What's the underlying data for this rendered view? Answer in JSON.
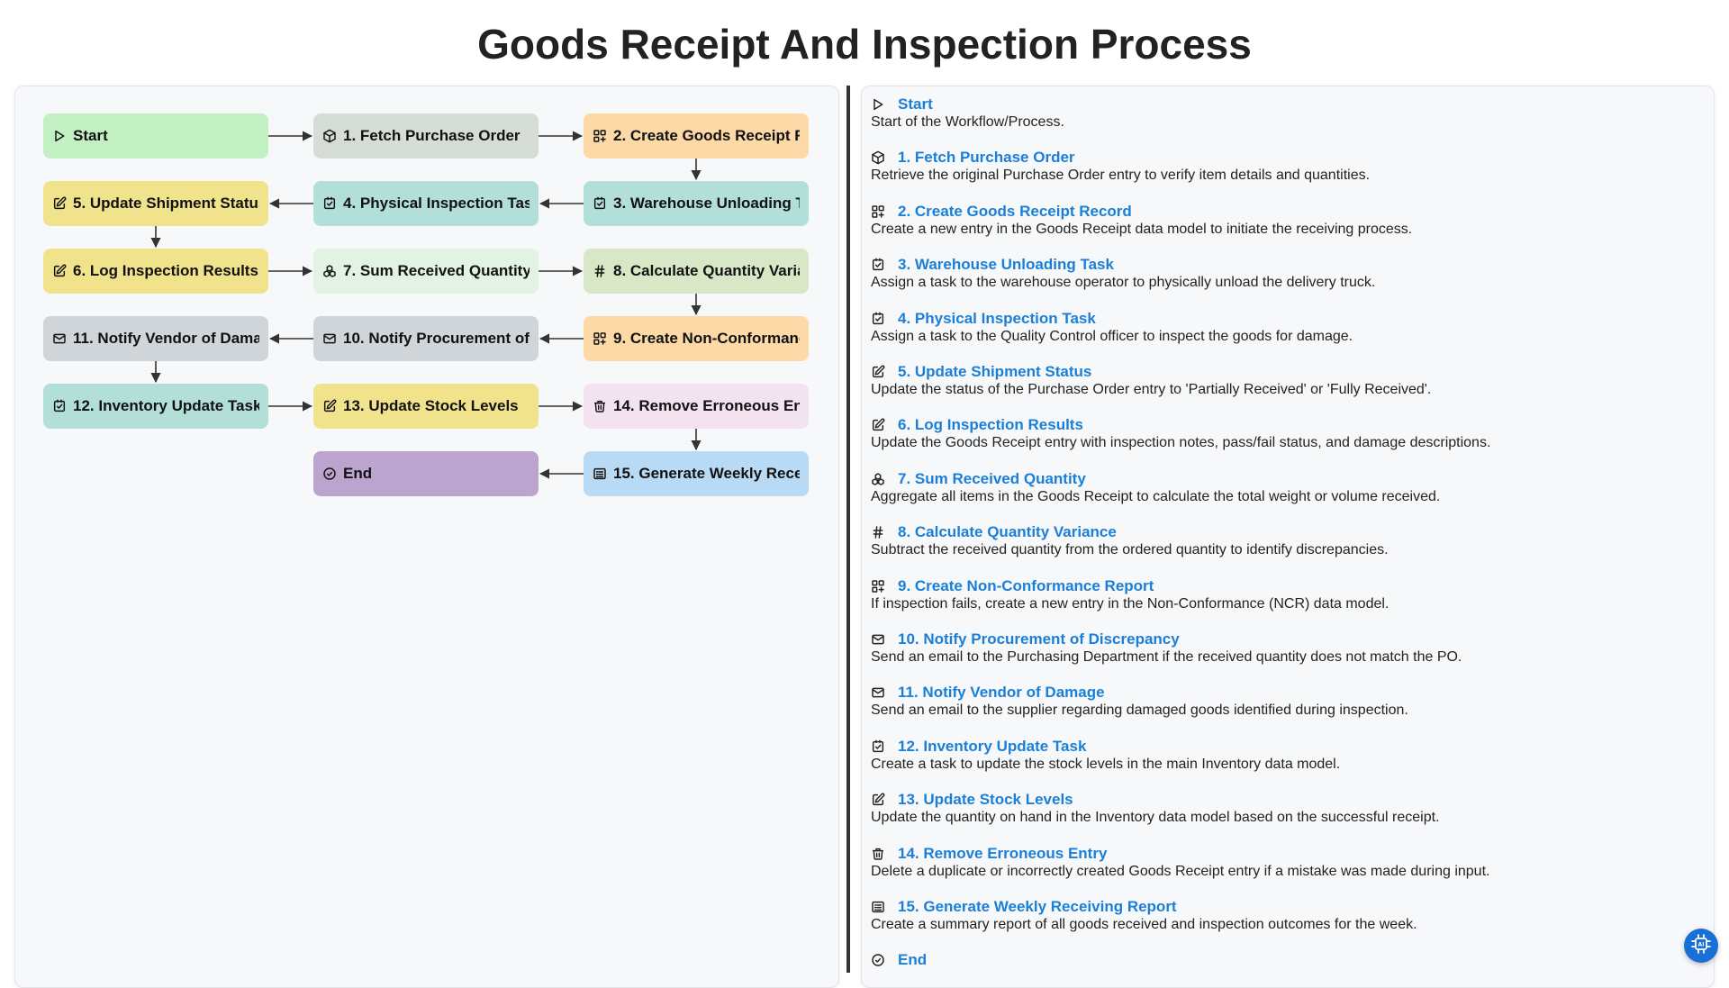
{
  "title": "Goods Receipt And Inspection Process",
  "colors": {
    "green": "#c2f0c2",
    "sage": "#d6ddd6",
    "orange": "#fdd9a8",
    "teal": "#b3dfd9",
    "yellow": "#f0e38c",
    "mint": "#e3f3e3",
    "lime": "#d8e8c6",
    "gray": "#d0d5d9",
    "pink": "#f3e3f1",
    "blue": "#b9daf5",
    "purple": "#bba5cf",
    "link": "#1a7fd8"
  },
  "nodes": [
    {
      "id": "start",
      "label": "Start",
      "icon": "play-icon",
      "color": "green"
    },
    {
      "id": "s1",
      "label": "1. Fetch Purchase Order",
      "icon": "cube-icon",
      "color": "sage"
    },
    {
      "id": "s2",
      "label": "2. Create Goods Receipt Record",
      "icon": "grid-plus-icon",
      "color": "orange"
    },
    {
      "id": "s3",
      "label": "3. Warehouse Unloading Task",
      "icon": "checkbox-icon",
      "color": "teal"
    },
    {
      "id": "s4",
      "label": "4. Physical Inspection Task",
      "icon": "checkbox-icon",
      "color": "teal"
    },
    {
      "id": "s5",
      "label": "5. Update Shipment Status",
      "icon": "edit-icon",
      "color": "yellow"
    },
    {
      "id": "s6",
      "label": "6. Log Inspection Results",
      "icon": "edit-icon",
      "color": "yellow"
    },
    {
      "id": "s7",
      "label": "7. Sum Received Quantity",
      "icon": "boxes-icon",
      "color": "mint"
    },
    {
      "id": "s8",
      "label": "8. Calculate Quantity Variance",
      "icon": "hash-icon",
      "color": "lime"
    },
    {
      "id": "s9",
      "label": "9. Create Non-Conformance Report",
      "icon": "grid-plus-icon",
      "color": "orange"
    },
    {
      "id": "s10",
      "label": "10. Notify Procurement of Discrepancy",
      "icon": "mail-icon",
      "color": "gray"
    },
    {
      "id": "s11",
      "label": "11. Notify Vendor of Damage",
      "icon": "mail-icon",
      "color": "gray"
    },
    {
      "id": "s12",
      "label": "12. Inventory Update Task",
      "icon": "checkbox-icon",
      "color": "teal"
    },
    {
      "id": "s13",
      "label": "13. Update Stock Levels",
      "icon": "edit-icon",
      "color": "yellow"
    },
    {
      "id": "s14",
      "label": "14. Remove Erroneous Entry",
      "icon": "trash-icon",
      "color": "pink"
    },
    {
      "id": "s15",
      "label": "15. Generate Weekly Receiving Report",
      "icon": "report-icon",
      "color": "blue"
    },
    {
      "id": "end",
      "label": "End",
      "icon": "check-circle-icon",
      "color": "purple"
    }
  ],
  "steps": [
    {
      "title": "Start",
      "icon": "play-icon",
      "desc": "Start of the Workflow/Process."
    },
    {
      "title": "1. Fetch Purchase Order",
      "icon": "cube-icon",
      "desc": "Retrieve the original Purchase Order entry to verify item details and quantities."
    },
    {
      "title": "2. Create Goods Receipt Record",
      "icon": "grid-plus-icon",
      "desc": "Create a new entry in the Goods Receipt data model to initiate the receiving process."
    },
    {
      "title": "3. Warehouse Unloading Task",
      "icon": "checkbox-icon",
      "desc": "Assign a task to the warehouse operator to physically unload the delivery truck."
    },
    {
      "title": "4. Physical Inspection Task",
      "icon": "checkbox-icon",
      "desc": "Assign a task to the Quality Control officer to inspect the goods for damage."
    },
    {
      "title": "5. Update Shipment Status",
      "icon": "edit-icon",
      "desc": "Update the status of the Purchase Order entry to 'Partially Received' or 'Fully Received'."
    },
    {
      "title": "6. Log Inspection Results",
      "icon": "edit-icon",
      "desc": "Update the Goods Receipt entry with inspection notes, pass/fail status, and damage descriptions."
    },
    {
      "title": "7. Sum Received Quantity",
      "icon": "boxes-icon",
      "desc": "Aggregate all items in the Goods Receipt to calculate the total weight or volume received."
    },
    {
      "title": "8. Calculate Quantity Variance",
      "icon": "hash-icon",
      "desc": "Subtract the received quantity from the ordered quantity to identify discrepancies."
    },
    {
      "title": "9. Create Non-Conformance Report",
      "icon": "grid-plus-icon",
      "desc": "If inspection fails, create a new entry in the Non-Conformance (NCR) data model."
    },
    {
      "title": "10. Notify Procurement of Discrepancy",
      "icon": "mail-icon",
      "desc": "Send an email to the Purchasing Department if the received quantity does not match the PO."
    },
    {
      "title": "11. Notify Vendor of Damage",
      "icon": "mail-icon",
      "desc": "Send an email to the supplier regarding damaged goods identified during inspection."
    },
    {
      "title": "12. Inventory Update Task",
      "icon": "checkbox-icon",
      "desc": "Create a task to update the stock levels in the main Inventory data model."
    },
    {
      "title": "13. Update Stock Levels",
      "icon": "edit-icon",
      "desc": "Update the quantity on hand in the Inventory data model based on the successful receipt."
    },
    {
      "title": "14. Remove Erroneous Entry",
      "icon": "trash-icon",
      "desc": "Delete a duplicate or incorrectly created Goods Receipt entry if a mistake was made during input."
    },
    {
      "title": "15. Generate Weekly Receiving Report",
      "icon": "report-icon",
      "desc": "Create a summary report of all goods received and inspection outcomes for the week."
    },
    {
      "title": "End",
      "icon": "check-circle-icon",
      "desc": ""
    }
  ],
  "fab_icon": "ai-chip-icon"
}
